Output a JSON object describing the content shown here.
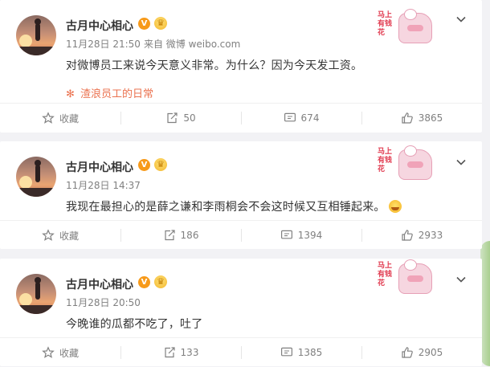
{
  "colors": {
    "accent": "#eb7350",
    "vbadge": "#f79a1a",
    "muted": "#808080",
    "page_bg": "#f2f2f5"
  },
  "posts": [
    {
      "user": {
        "name": "古月中心相心",
        "vbadge": "V"
      },
      "time": "11月28日 21:50",
      "source": "来自 微博 weibo.com",
      "text": "对微博员工来说今天意义非常。为什么？因为今天发工资。",
      "topic": "渣浪员工的日常",
      "sticker_text": "马上有钱花",
      "actions": {
        "favorite": "收藏",
        "repost": "50",
        "comment": "674",
        "like": "3865"
      }
    },
    {
      "user": {
        "name": "古月中心相心",
        "vbadge": "V"
      },
      "time": "11月28日 14:37",
      "source": "",
      "text": "我现在最担心的是薛之谦和李雨桐会不会这时候又互相锤起来。",
      "emoji": "laugh-cry-emoji",
      "sticker_text": "马上有钱花",
      "actions": {
        "favorite": "收藏",
        "repost": "186",
        "comment": "1394",
        "like": "2933"
      }
    },
    {
      "user": {
        "name": "古月中心相心",
        "vbadge": "V"
      },
      "time": "11月28日 20:50",
      "source": "",
      "text": "今晚谁的瓜都不吃了，吐了",
      "sticker_text": "马上有钱花",
      "actions": {
        "favorite": "收藏",
        "repost": "133",
        "comment": "1385",
        "like": "2905"
      }
    }
  ]
}
